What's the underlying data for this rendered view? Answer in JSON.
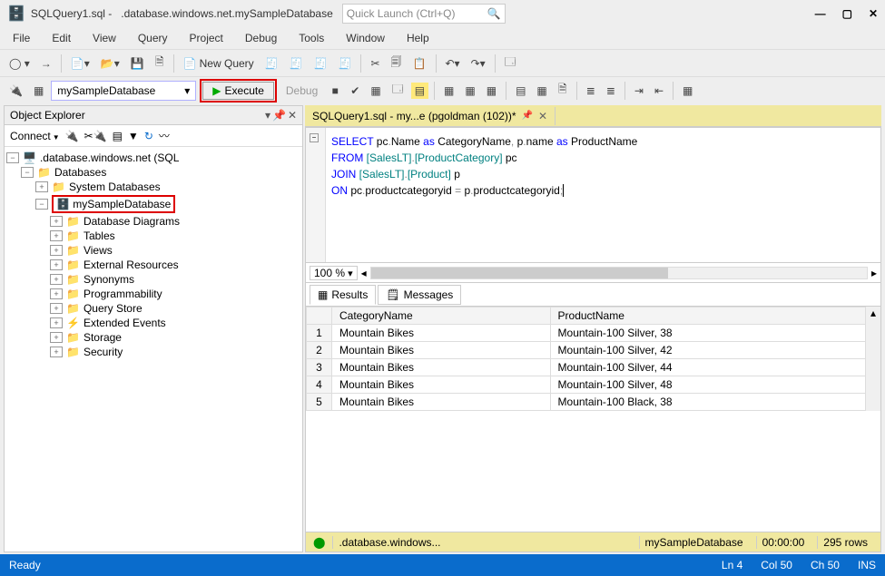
{
  "title": {
    "file": "SQLQuery1.sql -",
    "server": ".database.windows.net.mySampleDatabase"
  },
  "quicklaunch_placeholder": "Quick Launch (Ctrl+Q)",
  "menu": [
    "File",
    "Edit",
    "View",
    "Query",
    "Project",
    "Debug",
    "Tools",
    "Window",
    "Help"
  ],
  "toolbar1": {
    "newquery": "New Query"
  },
  "toolbar2": {
    "database": "mySampleDatabase",
    "execute": "Execute",
    "debug": "Debug"
  },
  "object_explorer": {
    "title": "Object Explorer",
    "connect": "Connect",
    "server": ".database.windows.net (SQL",
    "databases": "Databases",
    "sysdb": "System Databases",
    "userdb": "mySampleDatabase",
    "children": [
      "Database Diagrams",
      "Tables",
      "Views",
      "External Resources",
      "Synonyms",
      "Programmability",
      "Query Store",
      "Extended Events",
      "Storage",
      "Security"
    ]
  },
  "tab": {
    "label": "SQLQuery1.sql - my...e (pgoldman (102))*"
  },
  "code": {
    "l1a": "SELECT",
    "l1b": " pc",
    "l1c": ".",
    "l1d": "Name ",
    "l1e": "as",
    "l1f": " CategoryName",
    "l1g": ",",
    "l1h": " p",
    "l1i": ".",
    "l1j": "name ",
    "l1k": "as",
    "l1l": " ProductName",
    "l2a": "FROM",
    "l2b": " [SalesLT]",
    "l2c": ".",
    "l2d": "[ProductCategory]",
    "l2e": " pc",
    "l3a": "JOIN",
    "l3b": " [SalesLT]",
    "l3c": ".",
    "l3d": "[Product]",
    "l3e": " p",
    "l4a": "ON",
    "l4b": " pc",
    "l4c": ".",
    "l4d": "productcategoryid ",
    "l4e": "=",
    "l4f": " p",
    "l4g": ".",
    "l4h": "productcategoryid",
    "l4i": ";"
  },
  "zoom": "100 %",
  "results_tabs": {
    "results": "Results",
    "messages": "Messages"
  },
  "grid": {
    "cols": [
      "",
      "CategoryName",
      "ProductName"
    ],
    "rows": [
      [
        "1",
        "Mountain Bikes",
        "Mountain-100 Silver, 38"
      ],
      [
        "2",
        "Mountain Bikes",
        "Mountain-100 Silver, 42"
      ],
      [
        "3",
        "Mountain Bikes",
        "Mountain-100 Silver, 44"
      ],
      [
        "4",
        "Mountain Bikes",
        "Mountain-100 Silver, 48"
      ],
      [
        "5",
        "Mountain Bikes",
        "Mountain-100 Black, 38"
      ]
    ]
  },
  "editor_status": {
    "server": ".database.windows...",
    "db": "mySampleDatabase",
    "time": "00:00:00",
    "rows": "295 rows"
  },
  "status": {
    "ready": "Ready",
    "ln": "Ln 4",
    "col": "Col 50",
    "ch": "Ch 50",
    "ins": "INS"
  }
}
